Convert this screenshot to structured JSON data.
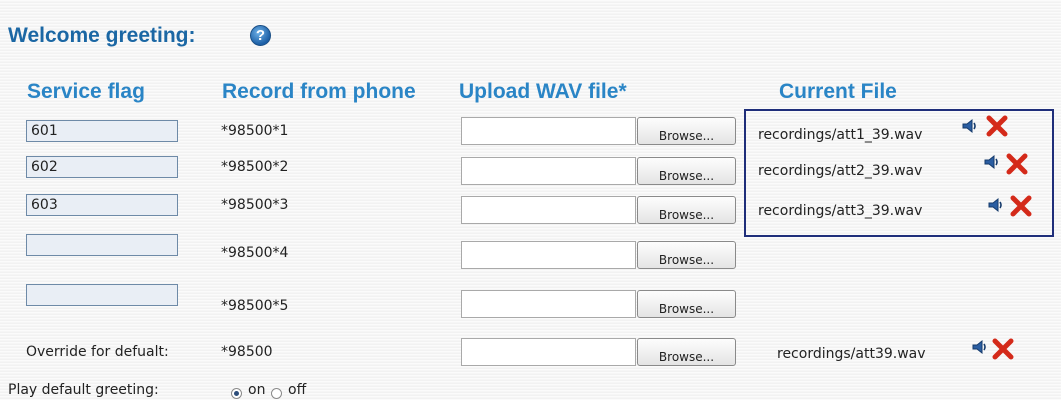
{
  "section": {
    "title": "Welcome greeting:",
    "help_icon": "help-icon"
  },
  "columns": {
    "service_flag": "Service flag",
    "record_from_phone": "Record from phone",
    "upload_wav": "Upload WAV file*",
    "current_file": "Current File"
  },
  "rows": [
    {
      "flag": "601",
      "code": "*98500*1",
      "browse": "Browse...",
      "current_file": "recordings/att1_39.wav"
    },
    {
      "flag": "602",
      "code": "*98500*2",
      "browse": "Browse...",
      "current_file": "recordings/att2_39.wav"
    },
    {
      "flag": "603",
      "code": "*98500*3",
      "browse": "Browse...",
      "current_file": "recordings/att3_39.wav"
    },
    {
      "flag": "",
      "code": "*98500*4",
      "browse": "Browse..."
    },
    {
      "flag": "",
      "code": "*98500*5",
      "browse": "Browse..."
    }
  ],
  "default_row": {
    "label": "Override for defualt:",
    "code": "*98500",
    "browse": "Browse...",
    "current_file": "recordings/att39.wav"
  },
  "play_default": {
    "label": "Play default greeting:",
    "on_label": "on",
    "off_label": "off",
    "selected": "on"
  },
  "icons": {
    "play": "speaker-icon",
    "delete": "delete-icon"
  },
  "colors": {
    "heading": "#1b67a4",
    "column_header": "#2a85c6",
    "box_border": "#1f2e7a",
    "delete": "#d42a1a"
  }
}
